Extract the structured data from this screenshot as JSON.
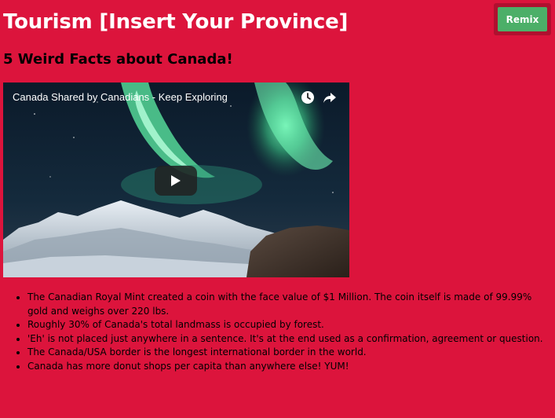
{
  "header": {
    "title": "Tourism [Insert Your Province]",
    "remix_label": "Remix",
    "remix_color": "#4caf68"
  },
  "main": {
    "subtitle": "5 Weird Facts about Canada!",
    "video": {
      "title": "Canada Shared by Canadians - Keep Exploring",
      "icons": [
        "clock-icon",
        "share-icon",
        "play-icon"
      ]
    },
    "facts": [
      "The Canadian Royal Mint created a coin with the face value of $1 Million. The coin itself is made of 99.99% gold and weighs over 220 lbs.",
      "Roughly 30% of Canada's total landmass is occupied by forest.",
      "'Eh' is not placed just anywhere in a sentence. It's at the end used as a confirmation, agreement or question.",
      "The Canada/USA border is the longest international border in the world.",
      "Canada has more donut shops per capita than anywhere else! YUM!"
    ]
  },
  "colors": {
    "background": "#dc143c",
    "title_text": "#ffffff"
  }
}
